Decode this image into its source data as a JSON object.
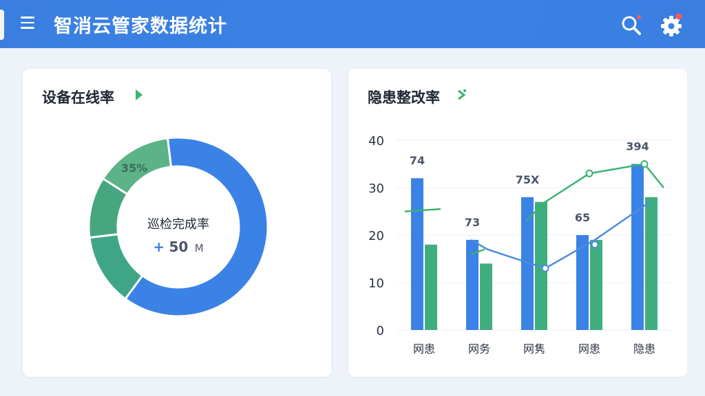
{
  "header": {
    "title": "智消云管家数据统计",
    "menu_icon": "hamburger-menu-icon",
    "search_icon": "search-icon",
    "settings_icon": "gear-icon",
    "colors": {
      "bar": "#3b82e6",
      "badge": "#ff5a5a"
    }
  },
  "left_card": {
    "title": "设备在线率",
    "title_icon": "play-arrow-icon",
    "accent": "#3bb273"
  },
  "right_card": {
    "title": "隐患整改率",
    "title_icon": "refresh-icon",
    "accent": "#3bb273"
  },
  "chart_data": [
    {
      "type": "pie",
      "variant": "donut",
      "center_label": "巡检完成率",
      "center_value_prefix": "+",
      "center_value": "50",
      "center_value_unit": "M",
      "slice_label": "35%",
      "slices": [
        {
          "value": 62,
          "color": "#3b82e6"
        },
        {
          "value": 13,
          "color": "#3fa587"
        },
        {
          "value": 11,
          "color": "#46a680"
        },
        {
          "value": 14,
          "color": "#5bb387"
        }
      ]
    },
    {
      "type": "bar",
      "categories": [
        "网患",
        "网务",
        "网隽",
        "网患",
        "隐患"
      ],
      "ylim": [
        0,
        40
      ],
      "yticks": [
        "0",
        "10",
        "20",
        "30",
        "40"
      ],
      "grid": true,
      "series": [
        {
          "values": [
            32,
            19,
            28,
            20,
            35
          ],
          "color": "#3b82e6",
          "labels": [
            "74",
            "73",
            "75X",
            "65",
            "394"
          ]
        },
        {
          "values": [
            18,
            14,
            27,
            19,
            28
          ],
          "color": "#3fae7f"
        }
      ],
      "lines": [
        {
          "color": "#4a8ce0",
          "segments": [
            [
              [
                0.85,
                19
              ],
              [
                1.15,
                17
              ],
              [
                2.2,
                13
              ],
              [
                3.1,
                19
              ],
              [
                4.1,
                27
              ]
            ]
          ],
          "markers": [
            [
              2.2,
              13
            ],
            [
              3.1,
              18
            ]
          ]
        },
        {
          "color": "#3bb273",
          "segments": [
            [
              [
                -0.35,
                25
              ],
              [
                0.3,
                25.5
              ]
            ],
            [
              [
                0.85,
                16
              ],
              [
                1.1,
                17
              ]
            ],
            [
              [
                1.85,
                23
              ],
              [
                2.2,
                27
              ],
              [
                3.0,
                33
              ],
              [
                4.0,
                35
              ],
              [
                4.35,
                30
              ]
            ]
          ],
          "markers": [
            [
              3.0,
              33
            ],
            [
              4.0,
              35
            ]
          ]
        }
      ]
    }
  ]
}
